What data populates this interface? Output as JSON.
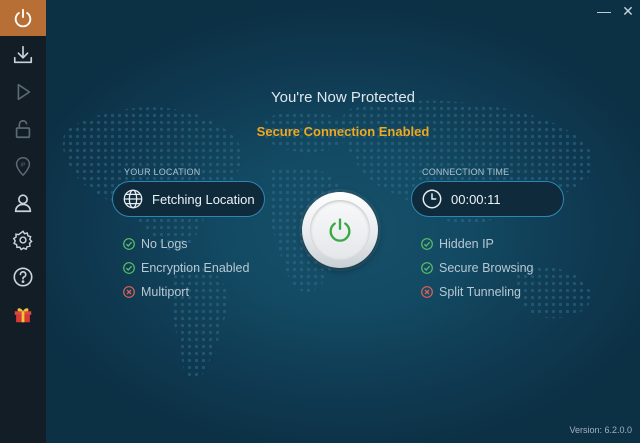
{
  "window": {
    "minimize_glyph": "—",
    "close_glyph": "✕"
  },
  "sidebar": {
    "items": [
      {
        "icon": "power-icon",
        "active": true
      },
      {
        "icon": "download-icon"
      },
      {
        "icon": "play-icon"
      },
      {
        "icon": "lock-icon"
      },
      {
        "icon": "ip-location-icon"
      },
      {
        "icon": "user-icon"
      },
      {
        "icon": "gear-icon"
      },
      {
        "icon": "help-icon"
      },
      {
        "icon": "gift-icon"
      }
    ],
    "ip_icon_text": "IP"
  },
  "status": {
    "title": "You're Now Protected",
    "subtitle": "Secure Connection Enabled"
  },
  "location": {
    "label": "YOUR LOCATION",
    "value": "Fetching Location"
  },
  "connection": {
    "label": "CONNECTION TIME",
    "value": "00:00:11"
  },
  "features_left": [
    {
      "label": "No Logs",
      "status": "enabled"
    },
    {
      "label": "Encryption Enabled",
      "status": "enabled"
    },
    {
      "label": "Multiport",
      "status": "disabled"
    }
  ],
  "features_right": [
    {
      "label": "Hidden IP",
      "status": "enabled"
    },
    {
      "label": "Secure Browsing",
      "status": "enabled"
    },
    {
      "label": "Split Tunneling",
      "status": "disabled"
    }
  ],
  "footer": {
    "version": "Version:  6.2.0.0"
  },
  "colors": {
    "accent": "#f0a81e",
    "active_tab": "#b86f35",
    "enabled": "#5bbf6a",
    "disabled": "#e0605a",
    "power_green": "#3aa845"
  }
}
